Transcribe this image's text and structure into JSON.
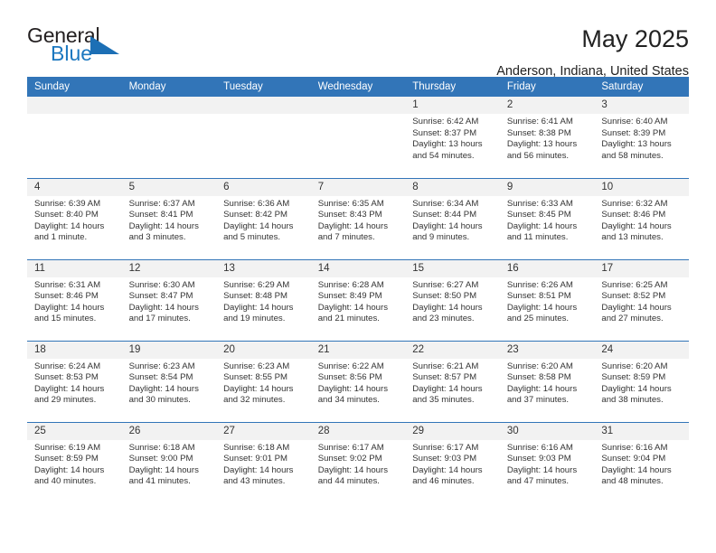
{
  "brand": {
    "name_part1": "General",
    "name_part2": "Blue",
    "accent_color": "#1c6fb5"
  },
  "header": {
    "title": "May 2025",
    "location": "Anderson, Indiana, United States",
    "header_bg_color": "#3275b8"
  },
  "calendar": {
    "weekday_headers": [
      "Sunday",
      "Monday",
      "Tuesday",
      "Wednesday",
      "Thursday",
      "Friday",
      "Saturday"
    ],
    "labels": {
      "sunrise": "Sunrise:",
      "sunset": "Sunset:",
      "daylight": "Daylight:"
    },
    "weeks": [
      [
        {
          "empty": true
        },
        {
          "empty": true
        },
        {
          "empty": true
        },
        {
          "empty": true
        },
        {
          "day": "1",
          "sunrise": "Sunrise: 6:42 AM",
          "sunset": "Sunset: 8:37 PM",
          "daylight_1": "Daylight: 13 hours",
          "daylight_2": "and 54 minutes."
        },
        {
          "day": "2",
          "sunrise": "Sunrise: 6:41 AM",
          "sunset": "Sunset: 8:38 PM",
          "daylight_1": "Daylight: 13 hours",
          "daylight_2": "and 56 minutes."
        },
        {
          "day": "3",
          "sunrise": "Sunrise: 6:40 AM",
          "sunset": "Sunset: 8:39 PM",
          "daylight_1": "Daylight: 13 hours",
          "daylight_2": "and 58 minutes."
        }
      ],
      [
        {
          "day": "4",
          "sunrise": "Sunrise: 6:39 AM",
          "sunset": "Sunset: 8:40 PM",
          "daylight_1": "Daylight: 14 hours",
          "daylight_2": "and 1 minute."
        },
        {
          "day": "5",
          "sunrise": "Sunrise: 6:37 AM",
          "sunset": "Sunset: 8:41 PM",
          "daylight_1": "Daylight: 14 hours",
          "daylight_2": "and 3 minutes."
        },
        {
          "day": "6",
          "sunrise": "Sunrise: 6:36 AM",
          "sunset": "Sunset: 8:42 PM",
          "daylight_1": "Daylight: 14 hours",
          "daylight_2": "and 5 minutes."
        },
        {
          "day": "7",
          "sunrise": "Sunrise: 6:35 AM",
          "sunset": "Sunset: 8:43 PM",
          "daylight_1": "Daylight: 14 hours",
          "daylight_2": "and 7 minutes."
        },
        {
          "day": "8",
          "sunrise": "Sunrise: 6:34 AM",
          "sunset": "Sunset: 8:44 PM",
          "daylight_1": "Daylight: 14 hours",
          "daylight_2": "and 9 minutes."
        },
        {
          "day": "9",
          "sunrise": "Sunrise: 6:33 AM",
          "sunset": "Sunset: 8:45 PM",
          "daylight_1": "Daylight: 14 hours",
          "daylight_2": "and 11 minutes."
        },
        {
          "day": "10",
          "sunrise": "Sunrise: 6:32 AM",
          "sunset": "Sunset: 8:46 PM",
          "daylight_1": "Daylight: 14 hours",
          "daylight_2": "and 13 minutes."
        }
      ],
      [
        {
          "day": "11",
          "sunrise": "Sunrise: 6:31 AM",
          "sunset": "Sunset: 8:46 PM",
          "daylight_1": "Daylight: 14 hours",
          "daylight_2": "and 15 minutes."
        },
        {
          "day": "12",
          "sunrise": "Sunrise: 6:30 AM",
          "sunset": "Sunset: 8:47 PM",
          "daylight_1": "Daylight: 14 hours",
          "daylight_2": "and 17 minutes."
        },
        {
          "day": "13",
          "sunrise": "Sunrise: 6:29 AM",
          "sunset": "Sunset: 8:48 PM",
          "daylight_1": "Daylight: 14 hours",
          "daylight_2": "and 19 minutes."
        },
        {
          "day": "14",
          "sunrise": "Sunrise: 6:28 AM",
          "sunset": "Sunset: 8:49 PM",
          "daylight_1": "Daylight: 14 hours",
          "daylight_2": "and 21 minutes."
        },
        {
          "day": "15",
          "sunrise": "Sunrise: 6:27 AM",
          "sunset": "Sunset: 8:50 PM",
          "daylight_1": "Daylight: 14 hours",
          "daylight_2": "and 23 minutes."
        },
        {
          "day": "16",
          "sunrise": "Sunrise: 6:26 AM",
          "sunset": "Sunset: 8:51 PM",
          "daylight_1": "Daylight: 14 hours",
          "daylight_2": "and 25 minutes."
        },
        {
          "day": "17",
          "sunrise": "Sunrise: 6:25 AM",
          "sunset": "Sunset: 8:52 PM",
          "daylight_1": "Daylight: 14 hours",
          "daylight_2": "and 27 minutes."
        }
      ],
      [
        {
          "day": "18",
          "sunrise": "Sunrise: 6:24 AM",
          "sunset": "Sunset: 8:53 PM",
          "daylight_1": "Daylight: 14 hours",
          "daylight_2": "and 29 minutes."
        },
        {
          "day": "19",
          "sunrise": "Sunrise: 6:23 AM",
          "sunset": "Sunset: 8:54 PM",
          "daylight_1": "Daylight: 14 hours",
          "daylight_2": "and 30 minutes."
        },
        {
          "day": "20",
          "sunrise": "Sunrise: 6:23 AM",
          "sunset": "Sunset: 8:55 PM",
          "daylight_1": "Daylight: 14 hours",
          "daylight_2": "and 32 minutes."
        },
        {
          "day": "21",
          "sunrise": "Sunrise: 6:22 AM",
          "sunset": "Sunset: 8:56 PM",
          "daylight_1": "Daylight: 14 hours",
          "daylight_2": "and 34 minutes."
        },
        {
          "day": "22",
          "sunrise": "Sunrise: 6:21 AM",
          "sunset": "Sunset: 8:57 PM",
          "daylight_1": "Daylight: 14 hours",
          "daylight_2": "and 35 minutes."
        },
        {
          "day": "23",
          "sunrise": "Sunrise: 6:20 AM",
          "sunset": "Sunset: 8:58 PM",
          "daylight_1": "Daylight: 14 hours",
          "daylight_2": "and 37 minutes."
        },
        {
          "day": "24",
          "sunrise": "Sunrise: 6:20 AM",
          "sunset": "Sunset: 8:59 PM",
          "daylight_1": "Daylight: 14 hours",
          "daylight_2": "and 38 minutes."
        }
      ],
      [
        {
          "day": "25",
          "sunrise": "Sunrise: 6:19 AM",
          "sunset": "Sunset: 8:59 PM",
          "daylight_1": "Daylight: 14 hours",
          "daylight_2": "and 40 minutes."
        },
        {
          "day": "26",
          "sunrise": "Sunrise: 6:18 AM",
          "sunset": "Sunset: 9:00 PM",
          "daylight_1": "Daylight: 14 hours",
          "daylight_2": "and 41 minutes."
        },
        {
          "day": "27",
          "sunrise": "Sunrise: 6:18 AM",
          "sunset": "Sunset: 9:01 PM",
          "daylight_1": "Daylight: 14 hours",
          "daylight_2": "and 43 minutes."
        },
        {
          "day": "28",
          "sunrise": "Sunrise: 6:17 AM",
          "sunset": "Sunset: 9:02 PM",
          "daylight_1": "Daylight: 14 hours",
          "daylight_2": "and 44 minutes."
        },
        {
          "day": "29",
          "sunrise": "Sunrise: 6:17 AM",
          "sunset": "Sunset: 9:03 PM",
          "daylight_1": "Daylight: 14 hours",
          "daylight_2": "and 46 minutes."
        },
        {
          "day": "30",
          "sunrise": "Sunrise: 6:16 AM",
          "sunset": "Sunset: 9:03 PM",
          "daylight_1": "Daylight: 14 hours",
          "daylight_2": "and 47 minutes."
        },
        {
          "day": "31",
          "sunrise": "Sunrise: 6:16 AM",
          "sunset": "Sunset: 9:04 PM",
          "daylight_1": "Daylight: 14 hours",
          "daylight_2": "and 48 minutes."
        }
      ]
    ]
  }
}
